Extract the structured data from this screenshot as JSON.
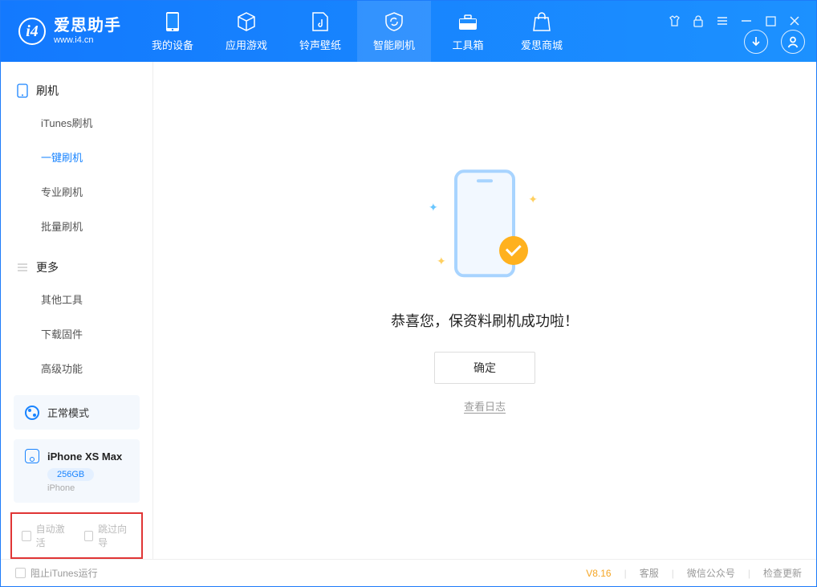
{
  "app": {
    "title": "爱思助手",
    "subtitle": "www.i4.cn"
  },
  "nav": [
    {
      "label": "我的设备"
    },
    {
      "label": "应用游戏"
    },
    {
      "label": "铃声壁纸"
    },
    {
      "label": "智能刷机"
    },
    {
      "label": "工具箱"
    },
    {
      "label": "爱思商城"
    }
  ],
  "sidebar": {
    "group1": {
      "title": "刷机",
      "items": [
        "iTunes刷机",
        "一键刷机",
        "专业刷机",
        "批量刷机"
      ],
      "active_index": 1
    },
    "group2": {
      "title": "更多",
      "items": [
        "其他工具",
        "下载固件",
        "高级功能"
      ]
    },
    "mode": "正常模式",
    "device": {
      "name": "iPhone XS Max",
      "storage": "256GB",
      "type": "iPhone"
    },
    "checks": {
      "auto_activate": "自动激活",
      "skip_guide": "跳过向导"
    }
  },
  "main": {
    "success_text": "恭喜您，保资料刷机成功啦！",
    "ok_button": "确定",
    "log_link": "查看日志"
  },
  "footer": {
    "block_itunes": "阻止iTunes运行",
    "version": "V8.16",
    "links": [
      "客服",
      "微信公众号",
      "检查更新"
    ]
  }
}
